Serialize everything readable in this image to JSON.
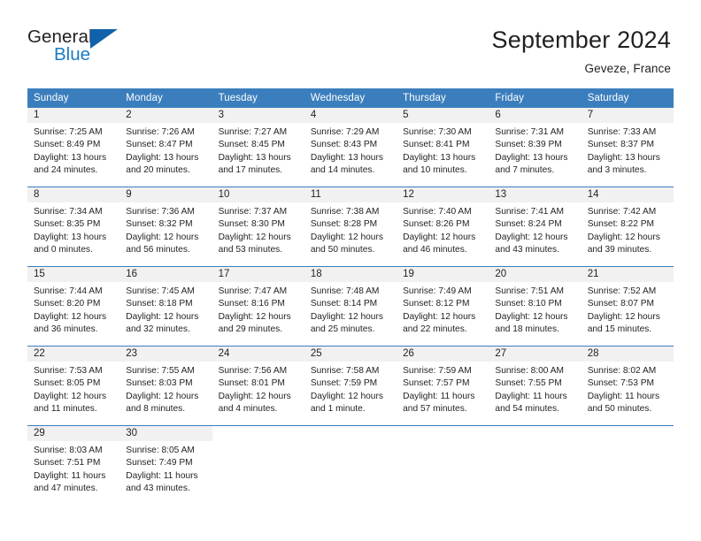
{
  "logo": {
    "word_top": "General",
    "word_bottom": "Blue",
    "triangle_icon": "triangle-icon",
    "accent_color": "#1a7bc5"
  },
  "header": {
    "title": "September 2024",
    "subtitle": "Geveze, France"
  },
  "theme": {
    "header_blue": "#3b7ebd",
    "daynum_band": "#f1f1f1",
    "text": "#231f20"
  },
  "calendar": {
    "weekday_headers": [
      "Sunday",
      "Monday",
      "Tuesday",
      "Wednesday",
      "Thursday",
      "Friday",
      "Saturday"
    ],
    "weeks": [
      [
        {
          "day": "1",
          "sunrise": "Sunrise: 7:25 AM",
          "sunset": "Sunset: 8:49 PM",
          "daylight1": "Daylight: 13 hours",
          "daylight2": "and 24 minutes."
        },
        {
          "day": "2",
          "sunrise": "Sunrise: 7:26 AM",
          "sunset": "Sunset: 8:47 PM",
          "daylight1": "Daylight: 13 hours",
          "daylight2": "and 20 minutes."
        },
        {
          "day": "3",
          "sunrise": "Sunrise: 7:27 AM",
          "sunset": "Sunset: 8:45 PM",
          "daylight1": "Daylight: 13 hours",
          "daylight2": "and 17 minutes."
        },
        {
          "day": "4",
          "sunrise": "Sunrise: 7:29 AM",
          "sunset": "Sunset: 8:43 PM",
          "daylight1": "Daylight: 13 hours",
          "daylight2": "and 14 minutes."
        },
        {
          "day": "5",
          "sunrise": "Sunrise: 7:30 AM",
          "sunset": "Sunset: 8:41 PM",
          "daylight1": "Daylight: 13 hours",
          "daylight2": "and 10 minutes."
        },
        {
          "day": "6",
          "sunrise": "Sunrise: 7:31 AM",
          "sunset": "Sunset: 8:39 PM",
          "daylight1": "Daylight: 13 hours",
          "daylight2": "and 7 minutes."
        },
        {
          "day": "7",
          "sunrise": "Sunrise: 7:33 AM",
          "sunset": "Sunset: 8:37 PM",
          "daylight1": "Daylight: 13 hours",
          "daylight2": "and 3 minutes."
        }
      ],
      [
        {
          "day": "8",
          "sunrise": "Sunrise: 7:34 AM",
          "sunset": "Sunset: 8:35 PM",
          "daylight1": "Daylight: 13 hours",
          "daylight2": "and 0 minutes."
        },
        {
          "day": "9",
          "sunrise": "Sunrise: 7:36 AM",
          "sunset": "Sunset: 8:32 PM",
          "daylight1": "Daylight: 12 hours",
          "daylight2": "and 56 minutes."
        },
        {
          "day": "10",
          "sunrise": "Sunrise: 7:37 AM",
          "sunset": "Sunset: 8:30 PM",
          "daylight1": "Daylight: 12 hours",
          "daylight2": "and 53 minutes."
        },
        {
          "day": "11",
          "sunrise": "Sunrise: 7:38 AM",
          "sunset": "Sunset: 8:28 PM",
          "daylight1": "Daylight: 12 hours",
          "daylight2": "and 50 minutes."
        },
        {
          "day": "12",
          "sunrise": "Sunrise: 7:40 AM",
          "sunset": "Sunset: 8:26 PM",
          "daylight1": "Daylight: 12 hours",
          "daylight2": "and 46 minutes."
        },
        {
          "day": "13",
          "sunrise": "Sunrise: 7:41 AM",
          "sunset": "Sunset: 8:24 PM",
          "daylight1": "Daylight: 12 hours",
          "daylight2": "and 43 minutes."
        },
        {
          "day": "14",
          "sunrise": "Sunrise: 7:42 AM",
          "sunset": "Sunset: 8:22 PM",
          "daylight1": "Daylight: 12 hours",
          "daylight2": "and 39 minutes."
        }
      ],
      [
        {
          "day": "15",
          "sunrise": "Sunrise: 7:44 AM",
          "sunset": "Sunset: 8:20 PM",
          "daylight1": "Daylight: 12 hours",
          "daylight2": "and 36 minutes."
        },
        {
          "day": "16",
          "sunrise": "Sunrise: 7:45 AM",
          "sunset": "Sunset: 8:18 PM",
          "daylight1": "Daylight: 12 hours",
          "daylight2": "and 32 minutes."
        },
        {
          "day": "17",
          "sunrise": "Sunrise: 7:47 AM",
          "sunset": "Sunset: 8:16 PM",
          "daylight1": "Daylight: 12 hours",
          "daylight2": "and 29 minutes."
        },
        {
          "day": "18",
          "sunrise": "Sunrise: 7:48 AM",
          "sunset": "Sunset: 8:14 PM",
          "daylight1": "Daylight: 12 hours",
          "daylight2": "and 25 minutes."
        },
        {
          "day": "19",
          "sunrise": "Sunrise: 7:49 AM",
          "sunset": "Sunset: 8:12 PM",
          "daylight1": "Daylight: 12 hours",
          "daylight2": "and 22 minutes."
        },
        {
          "day": "20",
          "sunrise": "Sunrise: 7:51 AM",
          "sunset": "Sunset: 8:10 PM",
          "daylight1": "Daylight: 12 hours",
          "daylight2": "and 18 minutes."
        },
        {
          "day": "21",
          "sunrise": "Sunrise: 7:52 AM",
          "sunset": "Sunset: 8:07 PM",
          "daylight1": "Daylight: 12 hours",
          "daylight2": "and 15 minutes."
        }
      ],
      [
        {
          "day": "22",
          "sunrise": "Sunrise: 7:53 AM",
          "sunset": "Sunset: 8:05 PM",
          "daylight1": "Daylight: 12 hours",
          "daylight2": "and 11 minutes."
        },
        {
          "day": "23",
          "sunrise": "Sunrise: 7:55 AM",
          "sunset": "Sunset: 8:03 PM",
          "daylight1": "Daylight: 12 hours",
          "daylight2": "and 8 minutes."
        },
        {
          "day": "24",
          "sunrise": "Sunrise: 7:56 AM",
          "sunset": "Sunset: 8:01 PM",
          "daylight1": "Daylight: 12 hours",
          "daylight2": "and 4 minutes."
        },
        {
          "day": "25",
          "sunrise": "Sunrise: 7:58 AM",
          "sunset": "Sunset: 7:59 PM",
          "daylight1": "Daylight: 12 hours",
          "daylight2": "and 1 minute."
        },
        {
          "day": "26",
          "sunrise": "Sunrise: 7:59 AM",
          "sunset": "Sunset: 7:57 PM",
          "daylight1": "Daylight: 11 hours",
          "daylight2": "and 57 minutes."
        },
        {
          "day": "27",
          "sunrise": "Sunrise: 8:00 AM",
          "sunset": "Sunset: 7:55 PM",
          "daylight1": "Daylight: 11 hours",
          "daylight2": "and 54 minutes."
        },
        {
          "day": "28",
          "sunrise": "Sunrise: 8:02 AM",
          "sunset": "Sunset: 7:53 PM",
          "daylight1": "Daylight: 11 hours",
          "daylight2": "and 50 minutes."
        }
      ],
      [
        {
          "day": "29",
          "sunrise": "Sunrise: 8:03 AM",
          "sunset": "Sunset: 7:51 PM",
          "daylight1": "Daylight: 11 hours",
          "daylight2": "and 47 minutes."
        },
        {
          "day": "30",
          "sunrise": "Sunrise: 8:05 AM",
          "sunset": "Sunset: 7:49 PM",
          "daylight1": "Daylight: 11 hours",
          "daylight2": "and 43 minutes."
        },
        {
          "day": "",
          "sunrise": "",
          "sunset": "",
          "daylight1": "",
          "daylight2": ""
        },
        {
          "day": "",
          "sunrise": "",
          "sunset": "",
          "daylight1": "",
          "daylight2": ""
        },
        {
          "day": "",
          "sunrise": "",
          "sunset": "",
          "daylight1": "",
          "daylight2": ""
        },
        {
          "day": "",
          "sunrise": "",
          "sunset": "",
          "daylight1": "",
          "daylight2": ""
        },
        {
          "day": "",
          "sunrise": "",
          "sunset": "",
          "daylight1": "",
          "daylight2": ""
        }
      ]
    ]
  }
}
